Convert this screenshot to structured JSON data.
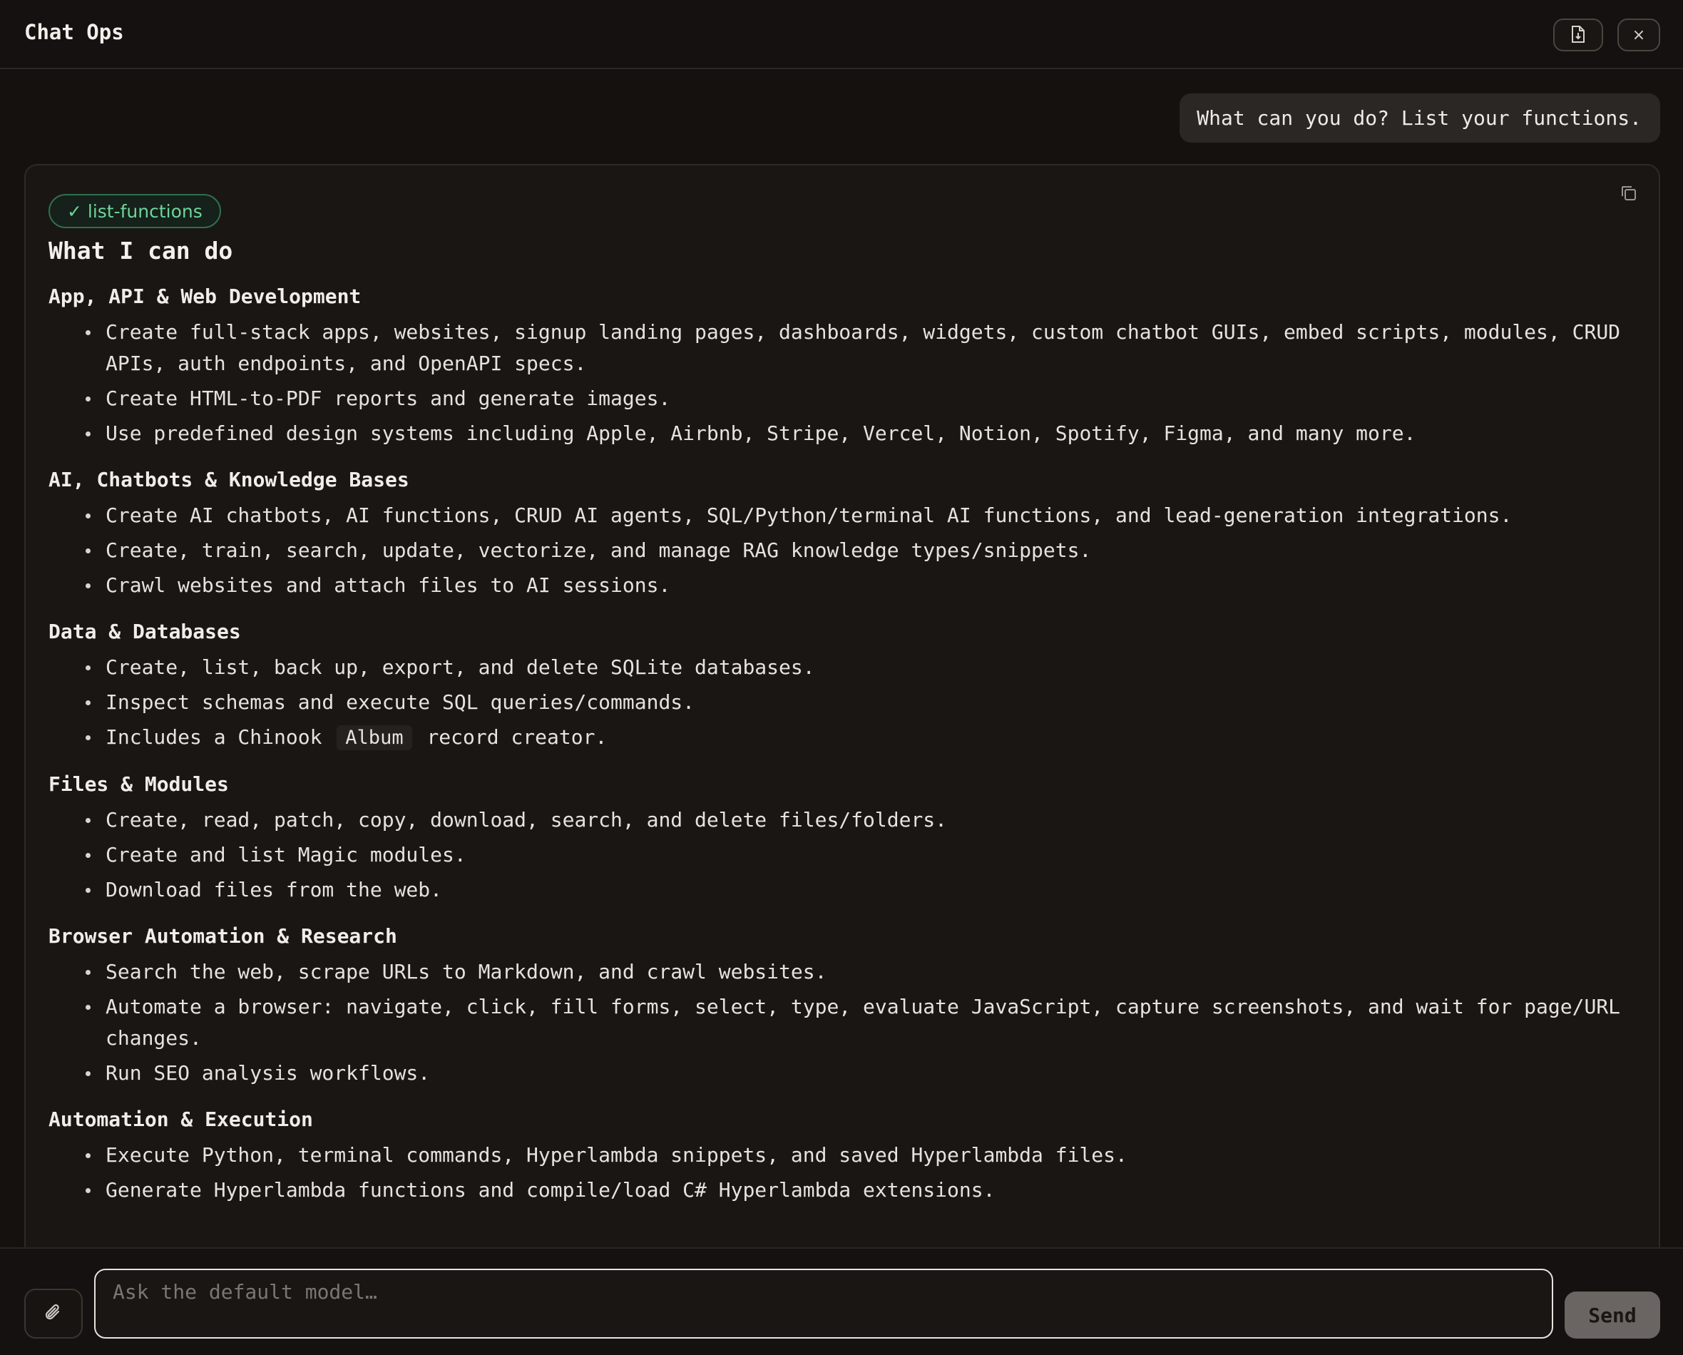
{
  "app": {
    "title": "Chat Ops",
    "export_icon": "file-export-icon",
    "close_symbol": "×"
  },
  "conversation": {
    "user_message": "What can you do? List your functions.",
    "tool_badge": "✓ list-functions",
    "heading": "What I can do",
    "sections": [
      {
        "title": "App, API & Web Development",
        "items": [
          "Create full-stack apps, websites, signup landing pages, dashboards, widgets, custom chatbot GUIs, embed scripts, modules, CRUD APIs, auth endpoints, and OpenAPI specs.",
          "Create HTML-to-PDF reports and generate images.",
          "Use predefined design systems including Apple, Airbnb, Stripe, Vercel, Notion, Spotify, Figma, and many more."
        ]
      },
      {
        "title": "AI, Chatbots & Knowledge Bases",
        "items": [
          "Create AI chatbots, AI functions, CRUD AI agents, SQL/Python/terminal AI functions, and lead-generation integrations.",
          "Create, train, search, update, vectorize, and manage RAG knowledge types/snippets.",
          "Crawl websites and attach files to AI sessions."
        ]
      },
      {
        "title": "Data & Databases",
        "items": [
          "Create, list, back up, export, and delete SQLite databases.",
          "Inspect schemas and execute SQL queries/commands."
        ],
        "chinook_prefix": "Includes a Chinook",
        "chinook_code": "Album",
        "chinook_suffix": "record creator."
      },
      {
        "title": "Files & Modules",
        "items": [
          "Create, read, patch, copy, download, search, and delete files/folders.",
          "Create and list Magic modules.",
          "Download files from the web."
        ]
      },
      {
        "title": "Browser Automation & Research",
        "items": [
          "Search the web, scrape URLs to Markdown, and crawl websites.",
          "Automate a browser: navigate, click, fill forms, select, type, evaluate JavaScript, capture screenshots, and wait for page/URL changes.",
          "Run SEO analysis workflows."
        ]
      },
      {
        "title": "Automation & Execution",
        "items": [
          "Execute Python, terminal commands, Hyperlambda snippets, and saved Hyperlambda files.",
          "Generate Hyperlambda functions and compile/load C# Hyperlambda extensions."
        ]
      }
    ]
  },
  "composer": {
    "placeholder": "Ask the default model…",
    "value": "",
    "send_label": "Send"
  }
}
